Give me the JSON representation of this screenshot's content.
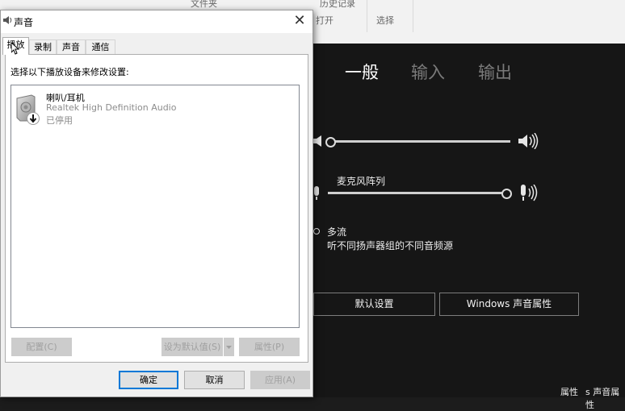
{
  "background_explorer": {
    "ribbon_item_top": "文件夹",
    "ribbon_history": "历史记录",
    "ribbon_group_open": "打开",
    "ribbon_group_select": "选择"
  },
  "background_settings": {
    "tabs": [
      {
        "label": "一般",
        "active": true
      },
      {
        "label": "输入",
        "active": false
      },
      {
        "label": "输出",
        "active": false
      }
    ],
    "speaker_volume_fraction": 0.0,
    "mic_label": "麦克风阵列",
    "mic_volume_fraction": 1.0,
    "option_label": "多流",
    "option_description": "听不同扬声器组的不同音频源",
    "buttons": {
      "default_settings": "默认设置",
      "windows_sound_properties": "Windows 声音属性"
    },
    "taskbar_fragment": "属性",
    "taskbar_fragment_2": "s 声音属性"
  },
  "dialog": {
    "title": "声音",
    "close_glyph": "✕",
    "tabs": [
      {
        "label": "播放",
        "active": true
      },
      {
        "label": "录制",
        "active": false
      },
      {
        "label": "声音",
        "active": false
      },
      {
        "label": "通信",
        "active": false
      }
    ],
    "instruction": "选择以下播放设备来修改设置:",
    "devices": [
      {
        "name": "喇叭/耳机",
        "driver": "Realtek High Definition Audio",
        "status": "已停用"
      }
    ],
    "buttons": {
      "configure": "配置(C)",
      "set_default": "设为默认值(S)",
      "properties": "属性(P)",
      "ok": "确定",
      "cancel": "取消",
      "apply": "应用(A)"
    }
  },
  "colors": {
    "accent_blue": "#0078d7",
    "dark_background": "#161616"
  }
}
